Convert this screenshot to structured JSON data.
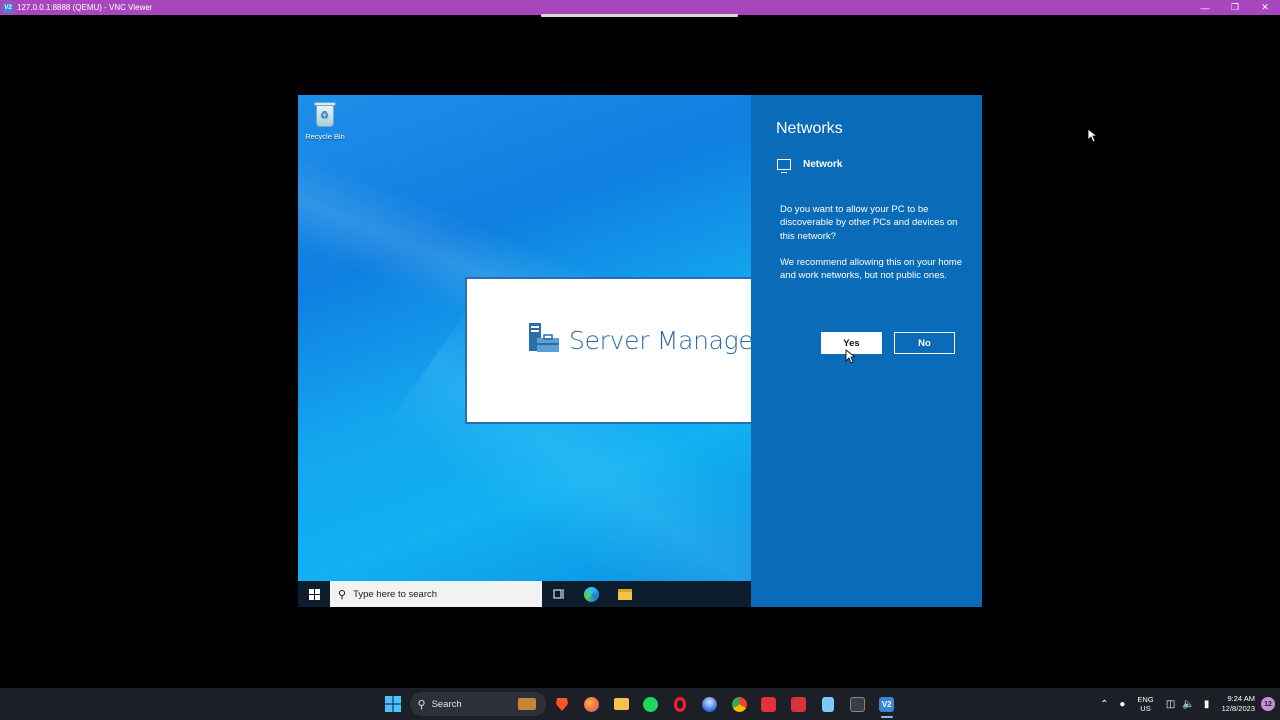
{
  "vnc": {
    "app_icon": "V2",
    "title": "127.0.0.1:8888 (QEMU) - VNC Viewer",
    "controls": [
      "minimize-icon",
      "restore-icon",
      "close-icon"
    ]
  },
  "desktop": {
    "recycle_bin_label": "Recycle Bin"
  },
  "splash": {
    "title": "Server Manager"
  },
  "guest_taskbar": {
    "search_placeholder": "Type here to search"
  },
  "flyout": {
    "title": "Networks",
    "network_name": "Network",
    "question": "Do you want to allow your PC to be discoverable by other PCs and devices on this network?",
    "recommendation": "We recommend allowing this on your home and work networks, but not public ones.",
    "yes_label": "Yes",
    "no_label": "No"
  },
  "host_taskbar": {
    "search_label": "Search",
    "apps": [
      "file-explorer",
      "brave",
      "firefox",
      "files",
      "spotify",
      "opera",
      "thunderbird",
      "chrome",
      "app-red-1",
      "app-red-2",
      "notepad",
      "terminal",
      "vnc-viewer"
    ],
    "lang_line1": "ENG",
    "lang_line2": "US",
    "time": "9:24 AM",
    "date": "12/8/2023",
    "notification_count": "12"
  }
}
